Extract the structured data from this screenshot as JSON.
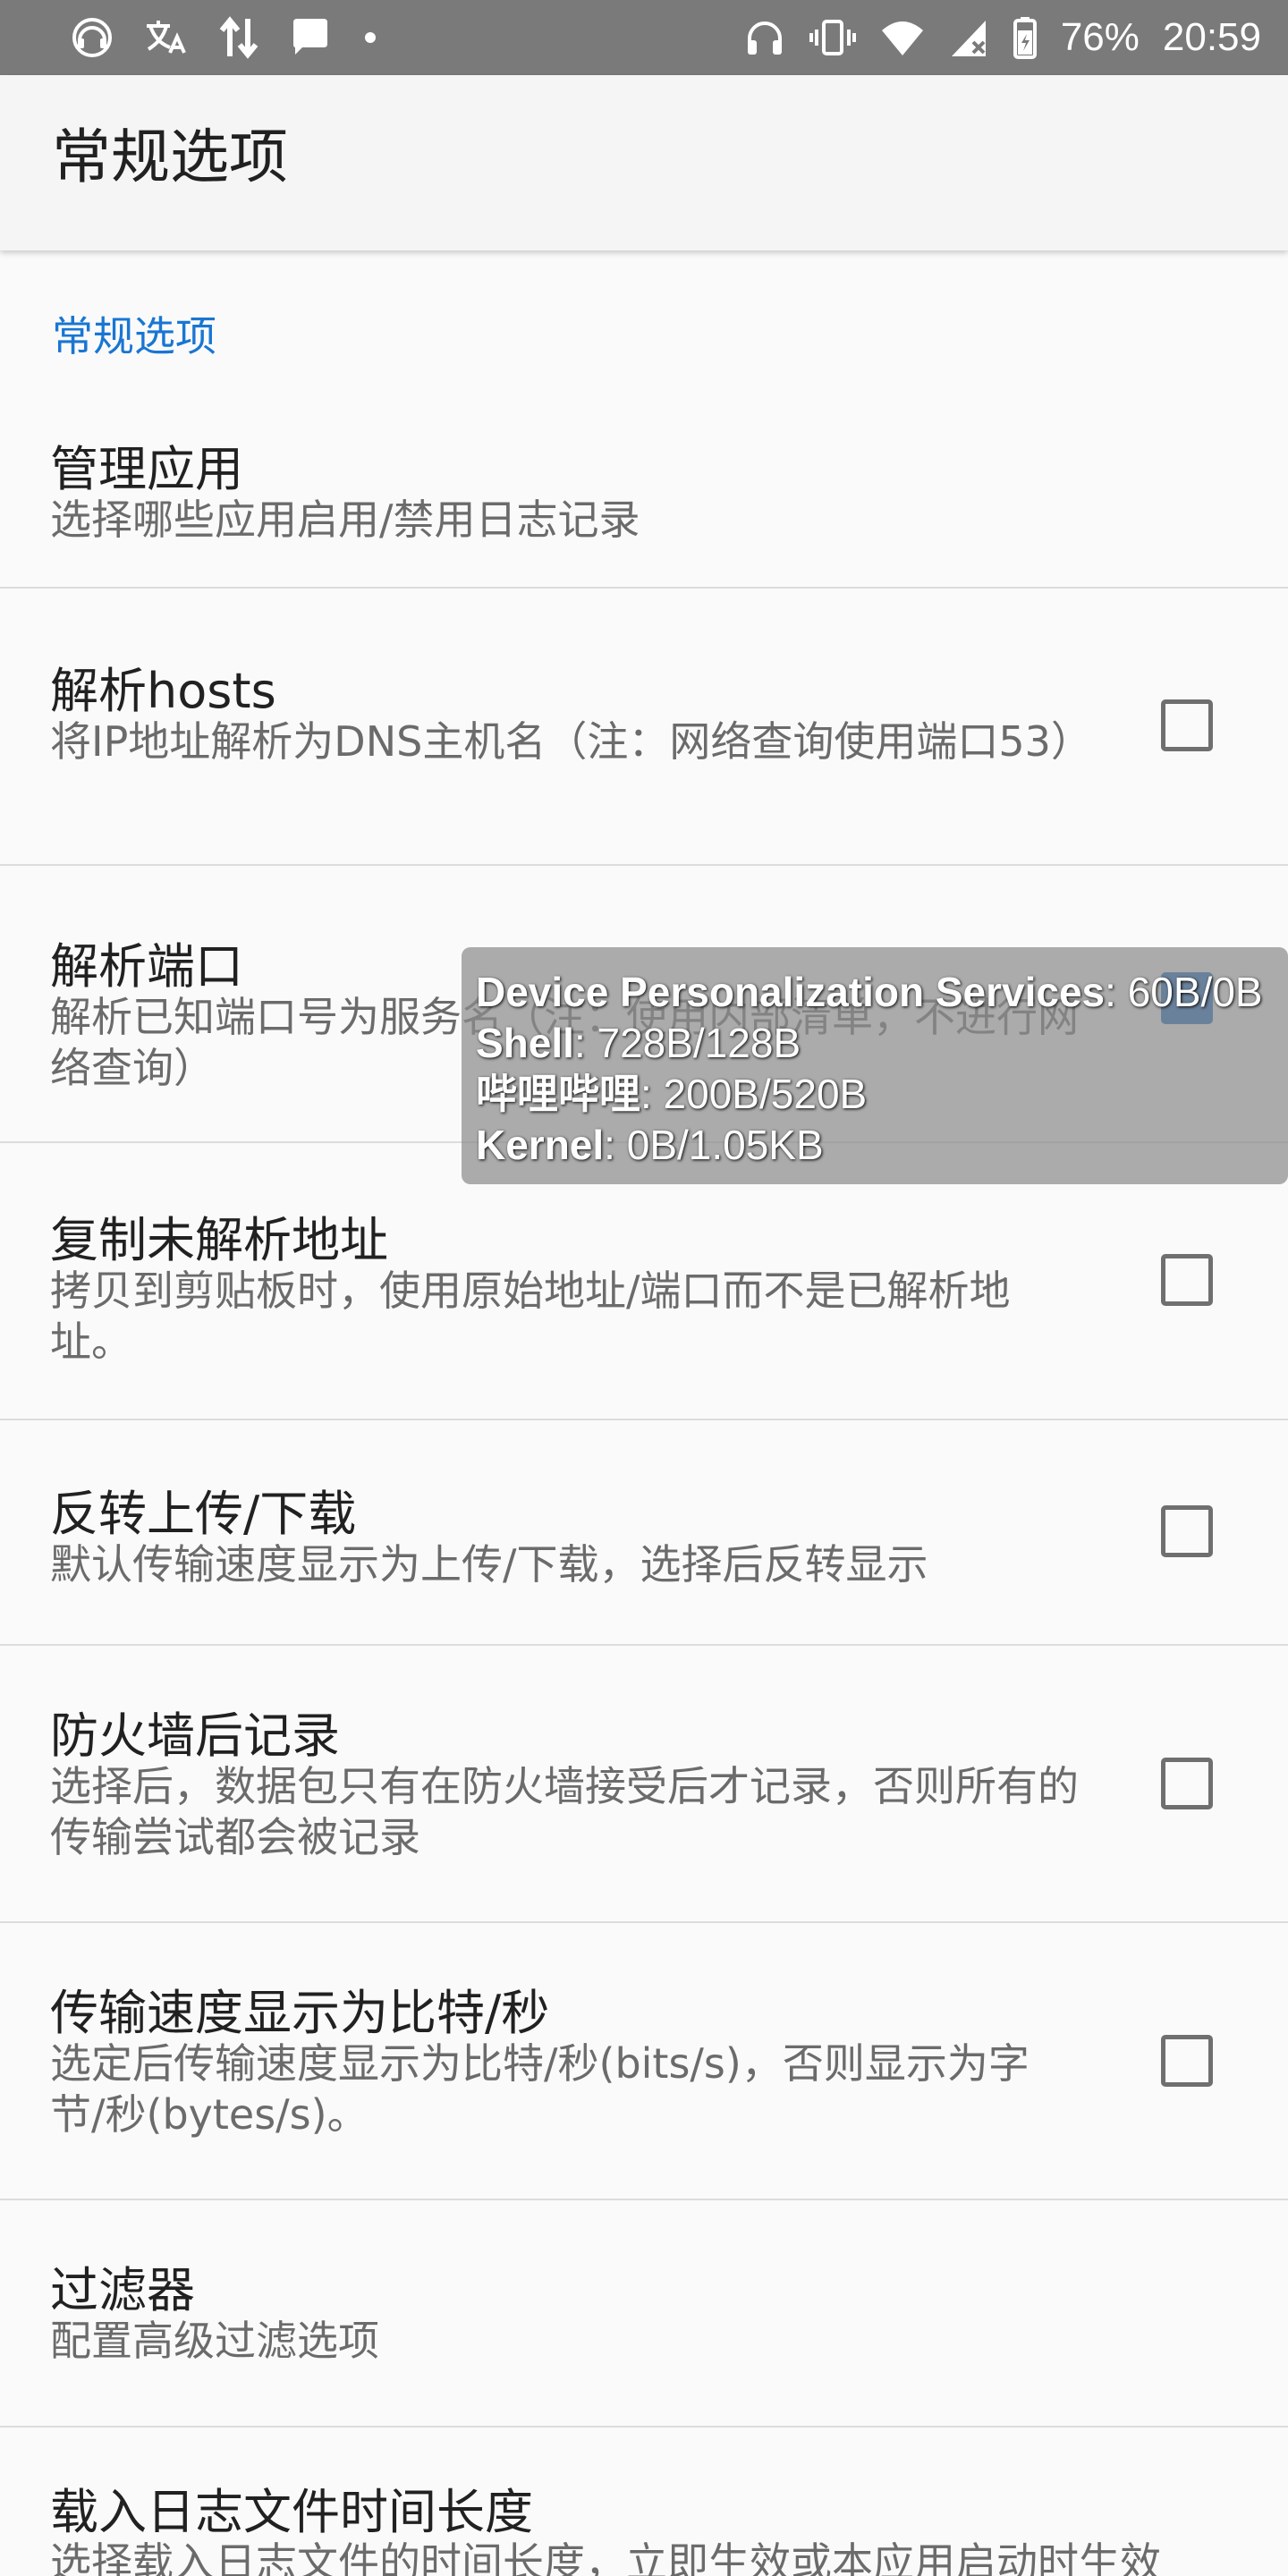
{
  "status_bar": {
    "battery": "76%",
    "time": "20:59",
    "left_icons": [
      "music-icon",
      "translate-icon",
      "data-transfer-icon",
      "message-icon",
      "dot-icon"
    ],
    "right_icons": [
      "headphones-icon",
      "vibrate-icon",
      "wifi-icon",
      "signal-icon",
      "battery-icon"
    ]
  },
  "app_bar": {
    "title": "常规选项"
  },
  "section": {
    "header": "常规选项"
  },
  "preferences": [
    {
      "title": "管理应用",
      "summary": "选择哪些应用启用/禁用日志记录",
      "checkbox": null
    },
    {
      "title": "解析hosts",
      "summary": "将IP地址解析为DNS主机名（注：网络查询使用端口53）",
      "checkbox": false
    },
    {
      "title": "解析端口",
      "summary": "解析已知端口号为服务名（注：使用内部清单，不进行网络查询）",
      "checkbox": true
    },
    {
      "title": "复制未解析地址",
      "summary": "拷贝到剪贴板时，使用原始地址/端口而不是已解析地址。",
      "checkbox": false
    },
    {
      "title": "反转上传/下载",
      "summary": "默认传输速度显示为上传/下载，选择后反转显示",
      "checkbox": false
    },
    {
      "title": "防火墙后记录",
      "summary": "选择后，数据包只有在防火墙接受后才记录，否则所有的传输尝试都会被记录",
      "checkbox": false
    },
    {
      "title": "传输速度显示为比特/秒",
      "summary": "选定后传输速度显示为比特/秒(bits/s)，否则显示为字节/秒(bytes/s)。",
      "checkbox": false
    },
    {
      "title": "过滤器",
      "summary": "配置高级过滤选项",
      "checkbox": null
    },
    {
      "title": "载入日志文件时间长度",
      "summary": "选择载入日志文件的时间长度，立即生效或本应用启动时生效",
      "checkbox": null
    }
  ],
  "overlay": {
    "rows": [
      {
        "name": "Device Personalization Services",
        "value": ": 60B/0B"
      },
      {
        "name": "Shell",
        "value": ": 728B/128B"
      },
      {
        "name": "哔哩哔哩",
        "value": ": 200B/520B"
      },
      {
        "name": "Kernel",
        "value": ": 0B/1.05KB"
      }
    ]
  },
  "colors": {
    "accent": "#1976d2",
    "checkbox_checked": "#1565c0",
    "status_bar": "#7a7a7a",
    "app_bar": "#f5f5f5"
  }
}
